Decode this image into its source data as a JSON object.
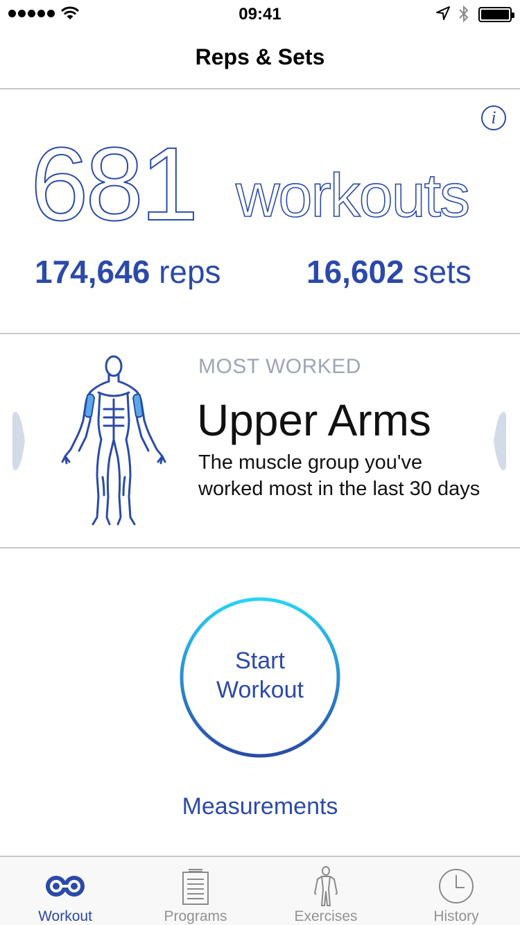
{
  "status_bar": {
    "time": "09:41",
    "signal_bars": 5
  },
  "nav": {
    "title": "Reps & Sets"
  },
  "summary": {
    "workouts_count": "681",
    "workouts_unit": "workouts",
    "reps_count": "174,646",
    "reps_unit": "reps",
    "sets_count": "16,602",
    "sets_unit": "sets",
    "info_icon": "info-icon"
  },
  "most_worked": {
    "label": "MOST WORKED",
    "muscle": "Upper Arms",
    "description": "The muscle group you've worked most in the last 30 days"
  },
  "start_button": {
    "line1": "Start",
    "line2": "Workout"
  },
  "measurements_link": "Measurements",
  "tabs": [
    {
      "label": "Workout",
      "icon": "dumbbell-icon",
      "active": true
    },
    {
      "label": "Programs",
      "icon": "clipboard-icon",
      "active": false
    },
    {
      "label": "Exercises",
      "icon": "person-icon",
      "active": false
    },
    {
      "label": "History",
      "icon": "clock-icon",
      "active": false
    }
  ],
  "colors": {
    "accent": "#2b4aa8",
    "muscle_highlight": "#5aa8e8",
    "ring_start": "#29d3f5",
    "ring_end": "#2b4aa8",
    "chevron": "#d3dbe9",
    "inactive_tab": "#929292"
  }
}
